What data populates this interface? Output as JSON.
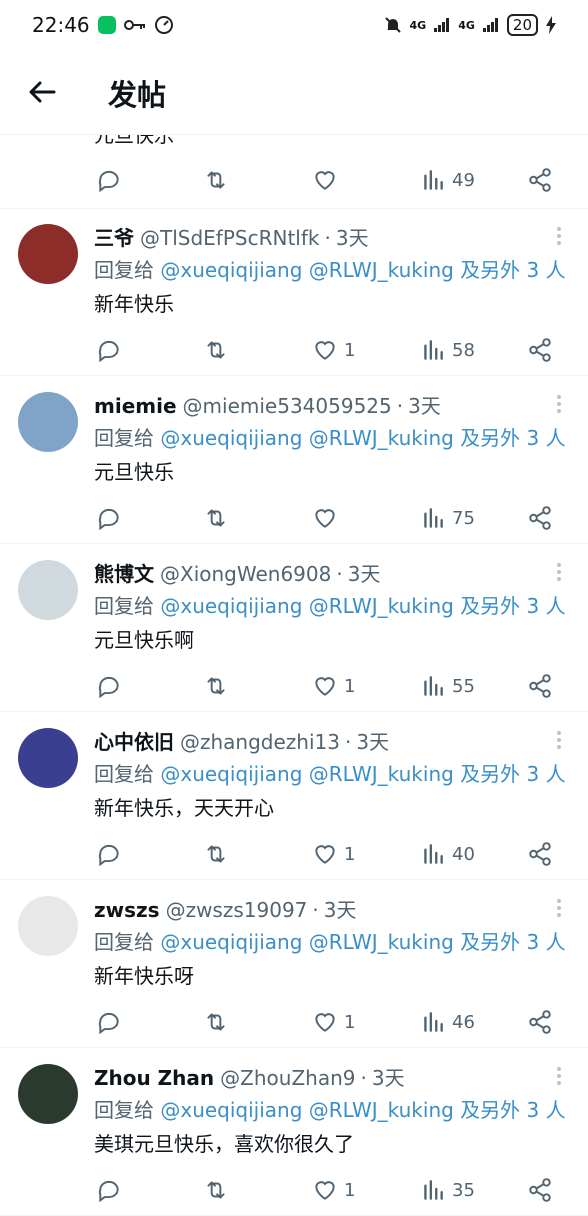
{
  "status_bar": {
    "time": "22:46",
    "network1": "4G",
    "network2": "4G",
    "battery": "20"
  },
  "header": {
    "title": "发帖"
  },
  "partial_post": {
    "text": "元旦快乐",
    "views": "49"
  },
  "replies": [
    {
      "avatar_color": "#8c2d2a",
      "name": "三爷",
      "handle": "@TlSdEfPScRNtlfk",
      "time": "3天",
      "reply_prefix": "回复给 ",
      "mention1": "@xueqiqijiang",
      "mention2": "@RLWJ_kuking",
      "reply_suffix": " 及另外 3 人",
      "text": "新年快乐",
      "likes": "1",
      "views": "58"
    },
    {
      "avatar_color": "#7fa4c8",
      "name": "miemie",
      "handle": "@miemie534059525",
      "time": "3天",
      "reply_prefix": "回复给 ",
      "mention1": "@xueqiqijiang",
      "mention2": "@RLWJ_kuking",
      "reply_suffix": " 及另外 3 人",
      "text": "元旦快乐",
      "likes": "",
      "views": "75"
    },
    {
      "avatar_color": "#cfd9de",
      "name": "熊博文",
      "handle": "@XiongWen6908",
      "time": "3天",
      "reply_prefix": "回复给 ",
      "mention1": "@xueqiqijiang",
      "mention2": "@RLWJ_kuking",
      "reply_suffix": " 及另外 3 人",
      "text": "元旦快乐啊",
      "likes": "1",
      "views": "55"
    },
    {
      "avatar_color": "#3b3f8f",
      "name": "心中依旧",
      "handle": "@zhangdezhi13",
      "time": "3天",
      "reply_prefix": "回复给 ",
      "mention1": "@xueqiqijiang",
      "mention2": "@RLWJ_kuking",
      "reply_suffix": " 及另外 3 人",
      "text": "新年快乐，天天开心",
      "likes": "1",
      "views": "40"
    },
    {
      "avatar_color": "#e8e8e8",
      "name": "zwszs",
      "handle": "@zwszs19097",
      "time": "3天",
      "reply_prefix": "回复给 ",
      "mention1": "@xueqiqijiang",
      "mention2": "@RLWJ_kuking",
      "reply_suffix": " 及另外 3 人",
      "text": "新年快乐呀",
      "likes": "1",
      "views": "46"
    },
    {
      "avatar_color": "#2b3a2f",
      "name": "Zhou Zhan",
      "handle": "@ZhouZhan9",
      "time": "3天",
      "reply_prefix": "回复给 ",
      "mention1": "@xueqiqijiang",
      "mention2": "@RLWJ_kuking",
      "reply_suffix": " 及另外 3 人",
      "text": "美琪元旦快乐，喜欢你很久了",
      "likes": "1",
      "views": "35"
    }
  ]
}
